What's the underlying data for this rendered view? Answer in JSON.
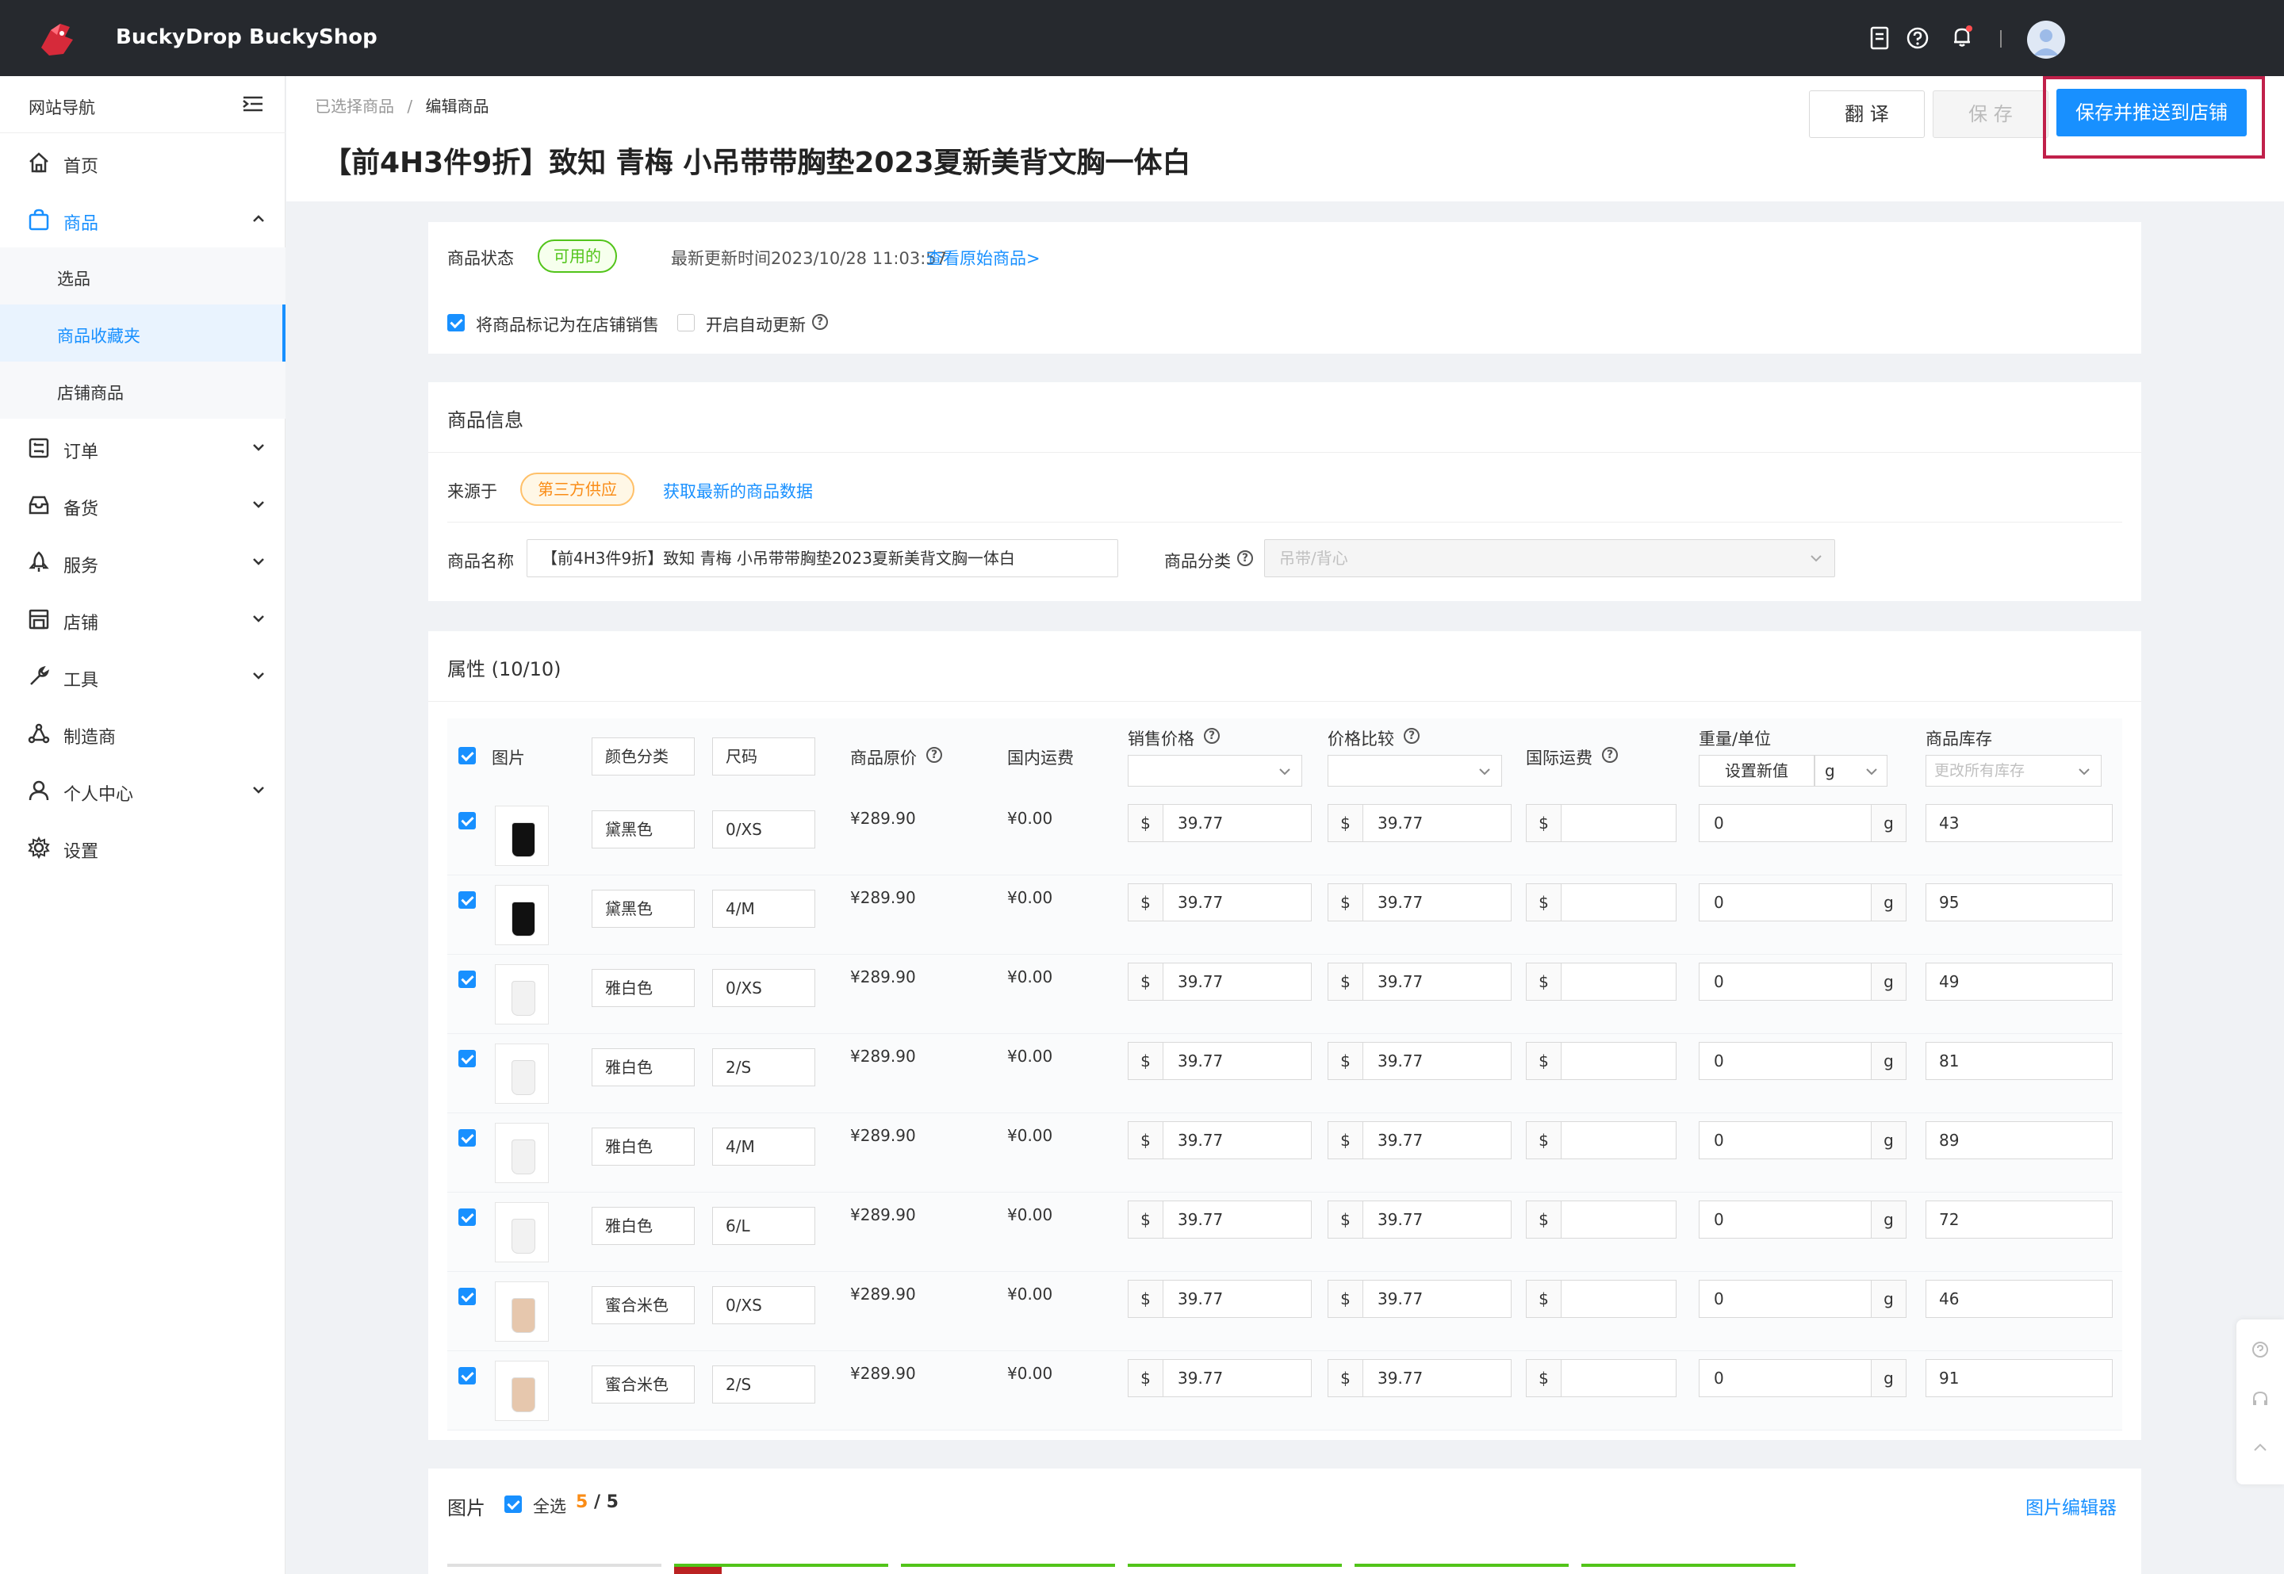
{
  "topbar": {
    "brand1": "BuckyDrop",
    "brand2": "BuckyShop"
  },
  "sidebar": {
    "title": "网站导航",
    "items": {
      "home": "首页",
      "products": "商品",
      "select": "选品",
      "favorites": "商品收藏夹",
      "store_products": "店铺商品",
      "orders": "订单",
      "stock": "备货",
      "service": "服务",
      "store": "店铺",
      "tools": "工具",
      "manufacturer": "制造商",
      "personal": "个人中心",
      "settings": "设置"
    }
  },
  "header": {
    "crumb1": "已选择商品",
    "crumb_sep": "/",
    "crumb2": "编辑商品",
    "title": "【前4H3件9折】致知 青梅 小吊带带胸垫2023夏新美背文胸一体白",
    "translate": "翻 译",
    "save": "保 存",
    "save_push": "保存并推送到店铺"
  },
  "status_card": {
    "status_label": "商品状态",
    "status_value": "可用的",
    "updated": "最新更新时间2023/10/28 11:03:57",
    "view_original": "查看原始商品>",
    "mark_selling": "将商品标记为在店铺销售",
    "auto_update": "开启自动更新"
  },
  "info_card": {
    "title": "商品信息",
    "source_label": "来源于",
    "source_value": "第三方供应",
    "fetch_latest": "获取最新的商品数据",
    "name_label": "商品名称",
    "name_value": "【前4H3件9折】致知 青梅 小吊带带胸垫2023夏新美背文胸一体白",
    "category_label": "商品分类",
    "category_value": "吊带/背心"
  },
  "attr_card": {
    "title": "属性 (10/10)",
    "headers": {
      "image": "图片",
      "color": "颜色分类",
      "size": "尺码",
      "original_price": "商品原价",
      "domestic_ship": "国内运费",
      "sale_price": "销售价格",
      "compare_price": "价格比较",
      "intl_ship": "国际运费",
      "weight": "重量/单位",
      "set_new": "设置新值",
      "unit": "g",
      "stock": "商品库存",
      "stock_placeholder": "更改所有库存"
    },
    "currency": "$",
    "weight_unit": "g",
    "rows": [
      {
        "color": "黛黑色",
        "size": "0/XS",
        "orig": "¥289.90",
        "ship": "¥0.00",
        "sale": "39.77",
        "compare": "39.77",
        "weight": "0",
        "stock": "43",
        "shade": "#111111"
      },
      {
        "color": "黛黑色",
        "size": "4/M",
        "orig": "¥289.90",
        "ship": "¥0.00",
        "sale": "39.77",
        "compare": "39.77",
        "weight": "0",
        "stock": "95",
        "shade": "#111111"
      },
      {
        "color": "雅白色",
        "size": "0/XS",
        "orig": "¥289.90",
        "ship": "¥0.00",
        "sale": "39.77",
        "compare": "39.77",
        "weight": "0",
        "stock": "49",
        "shade": "#f2f2f2"
      },
      {
        "color": "雅白色",
        "size": "2/S",
        "orig": "¥289.90",
        "ship": "¥0.00",
        "sale": "39.77",
        "compare": "39.77",
        "weight": "0",
        "stock": "81",
        "shade": "#f2f2f2"
      },
      {
        "color": "雅白色",
        "size": "4/M",
        "orig": "¥289.90",
        "ship": "¥0.00",
        "sale": "39.77",
        "compare": "39.77",
        "weight": "0",
        "stock": "89",
        "shade": "#f2f2f2"
      },
      {
        "color": "雅白色",
        "size": "6/L",
        "orig": "¥289.90",
        "ship": "¥0.00",
        "sale": "39.77",
        "compare": "39.77",
        "weight": "0",
        "stock": "72",
        "shade": "#f2f2f2"
      },
      {
        "color": "蜜合米色",
        "size": "0/XS",
        "orig": "¥289.90",
        "ship": "¥0.00",
        "sale": "39.77",
        "compare": "39.77",
        "weight": "0",
        "stock": "46",
        "shade": "#e6c7ad"
      },
      {
        "color": "蜜合米色",
        "size": "2/S",
        "orig": "¥289.90",
        "ship": "¥0.00",
        "sale": "39.77",
        "compare": "39.77",
        "weight": "0",
        "stock": "91",
        "shade": "#e6c7ad"
      }
    ]
  },
  "image_card": {
    "title": "图片",
    "select_all": "全选",
    "count_selected": "5",
    "count_sep": " / ",
    "count_total": "5",
    "editor": "图片编辑器"
  },
  "colors": {
    "accent": "#1890ff",
    "topbar": "#26292e",
    "highlight": "#c0204a",
    "success": "#52c41a",
    "warning": "#fa8c16"
  }
}
